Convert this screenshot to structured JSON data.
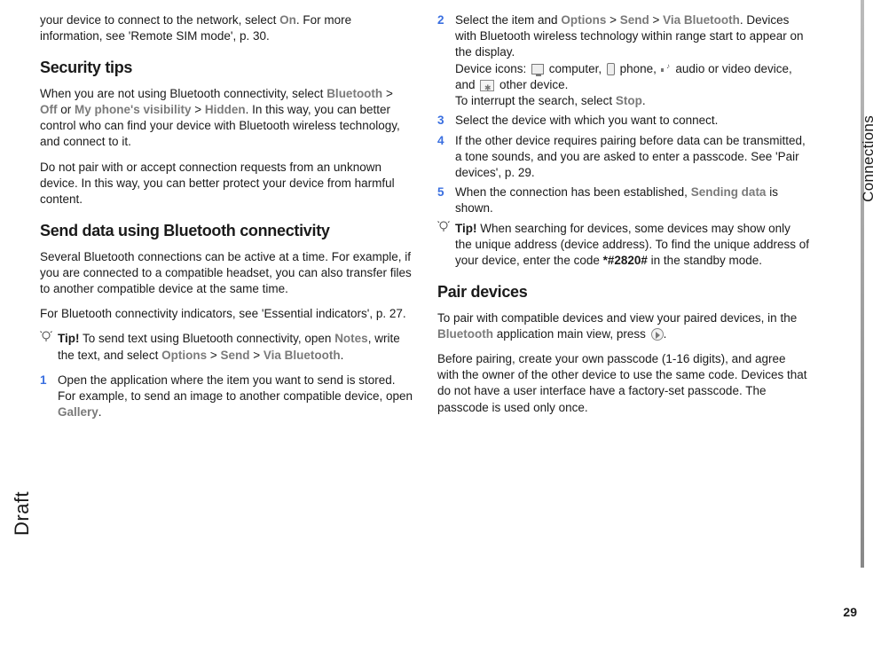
{
  "sideLabels": {
    "draft": "Draft",
    "section": "Connections",
    "pageNumber": "29"
  },
  "leftColumn": {
    "topFragment": {
      "pre": "your device to connect to the network, select ",
      "on": "On",
      "post": ". For more information, see 'Remote SIM mode', p. 30."
    },
    "securityTipsHeading": "Security tips",
    "securityP1": {
      "a": "When you are not using Bluetooth connectivity, select ",
      "b": "Bluetooth",
      "c": " > ",
      "d": "Off",
      "e": " or ",
      "f": "My phone's visibility",
      "g": " > ",
      "h": "Hidden",
      "i": ". In this way, you can better control who can find your device with Bluetooth wireless technology, and connect to it."
    },
    "securityP2": "Do not pair with or accept connection requests from an unknown device. In this way, you can better protect your device from harmful content.",
    "sendHeading": "Send data using Bluetooth connectivity",
    "sendP1": "Several Bluetooth connections can be active at a time. For example, if you are connected to a compatible headset, you can also transfer files to another compatible device at the same time.",
    "sendP2": "For Bluetooth connectivity indicators, see 'Essential indicators', p. 27.",
    "tip1": {
      "label": "Tip!",
      "a": " To send text using Bluetooth connectivity, open ",
      "b": "Notes",
      "c": ", write the text, and select ",
      "d": "Options",
      "e": " > ",
      "f": "Send",
      "g": " > ",
      "h": "Via Bluetooth",
      "i": "."
    },
    "step1": {
      "num": "1",
      "a": "Open the application where the item you want to send is stored. For example, to send an image to another compatible device, open ",
      "b": "Gallery",
      "c": "."
    }
  },
  "rightColumn": {
    "step2": {
      "num": "2",
      "a": "Select the item and ",
      "b": "Options",
      "c": " > ",
      "d": "Send",
      "e": " > ",
      "f": "Via Bluetooth",
      "g": ". Devices with Bluetooth wireless technology within range start to appear on the display.",
      "line3a": "Device icons: ",
      "line3b": " computer, ",
      "line3c": " phone, ",
      "line3d": " audio or video device, and ",
      "line3e": " other device.",
      "line4a": "To interrupt the search, select ",
      "line4b": "Stop",
      "line4c": "."
    },
    "step3": {
      "num": "3",
      "text": "Select the device with which you want to connect."
    },
    "step4": {
      "num": "4",
      "text": "If the other device requires pairing before data can be transmitted, a tone sounds, and you are asked to enter a passcode. See 'Pair devices', p. 29."
    },
    "step5": {
      "num": "5",
      "a": "When the connection has been established, ",
      "b": "Sending data",
      "c": " is shown."
    },
    "tip2": {
      "label": "Tip!",
      "a": " When searching for devices, some devices may show only the unique address (device address). To find the unique address of your device, enter the code ",
      "b": "*#2820#",
      "c": " in the standby mode."
    },
    "pairHeading": "Pair devices",
    "pairP1": {
      "a": "To pair with compatible devices and view your paired devices, in the ",
      "b": "Bluetooth",
      "c": " application main view, press ",
      "d": "."
    },
    "pairP2": "Before pairing, create your own passcode (1-16 digits), and agree with the owner of the other device to use the same code. Devices that do not have a user interface have a factory-set passcode. The passcode is used only once."
  }
}
